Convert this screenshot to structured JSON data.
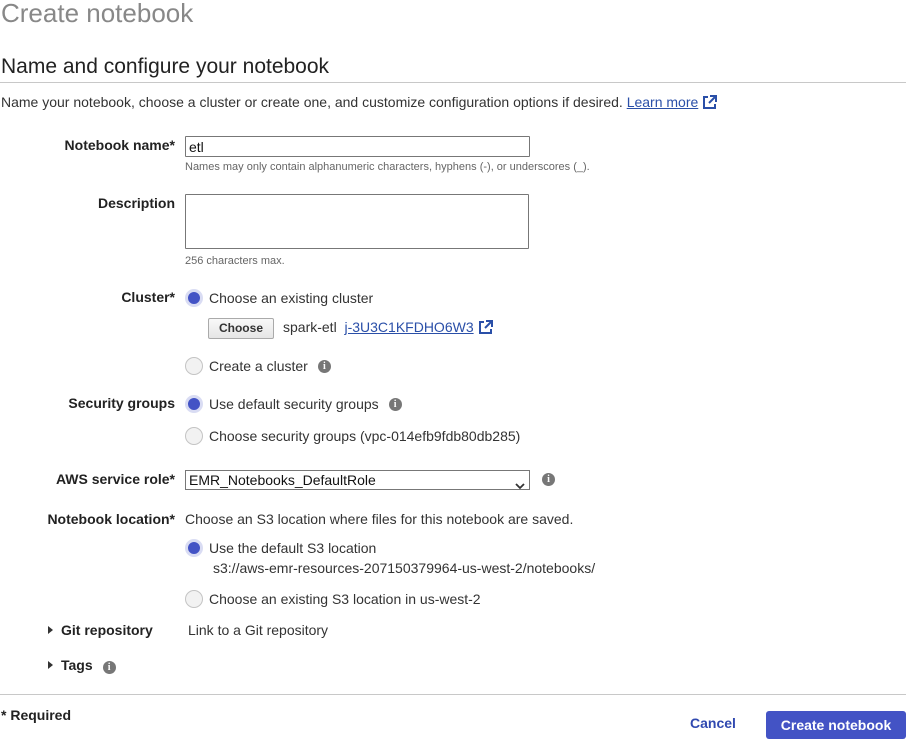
{
  "page": {
    "title": "Create notebook"
  },
  "section": {
    "title": "Name and configure your notebook",
    "intro": "Name your notebook, choose a cluster or create one, and customize configuration options if desired.",
    "learn_more": "Learn more"
  },
  "notebook_name": {
    "label": "Notebook name*",
    "value": "etl",
    "hint": "Names may only contain alphanumeric characters, hyphens (-), or underscores (_)."
  },
  "description": {
    "label": "Description",
    "value": "",
    "hint": "256 characters max."
  },
  "cluster": {
    "label": "Cluster*",
    "option_existing": "Choose an existing cluster",
    "choose_button": "Choose",
    "cluster_name": "spark-etl",
    "cluster_id": "j-3U3C1KFDHO6W3",
    "option_create": "Create a cluster",
    "selected": "existing"
  },
  "security_groups": {
    "label": "Security groups",
    "option_default": "Use default security groups",
    "option_choose": "Choose security groups (vpc-014efb9fdb80db285)",
    "selected": "default"
  },
  "service_role": {
    "label": "AWS service role*",
    "value": "EMR_Notebooks_DefaultRole"
  },
  "location": {
    "label": "Notebook location*",
    "description": "Choose an S3 location where files for this notebook are saved.",
    "option_default": "Use the default S3 location",
    "default_path": "s3://aws-emr-resources-207150379964-us-west-2/notebooks/",
    "option_existing": "Choose an existing S3 location in us-west-2",
    "selected": "default"
  },
  "git": {
    "label": "Git repository",
    "link": "Link to a Git repository"
  },
  "tags": {
    "label": "Tags"
  },
  "footer": {
    "required_note": "* Required",
    "cancel": "Cancel",
    "create": "Create notebook"
  },
  "icons": {
    "info": "info-icon",
    "external": "external-link-icon",
    "expand": "caret-right-icon",
    "dropdown": "chevron-down-icon"
  },
  "colors": {
    "primary": "#4353c5",
    "link": "#2a4fa8"
  }
}
